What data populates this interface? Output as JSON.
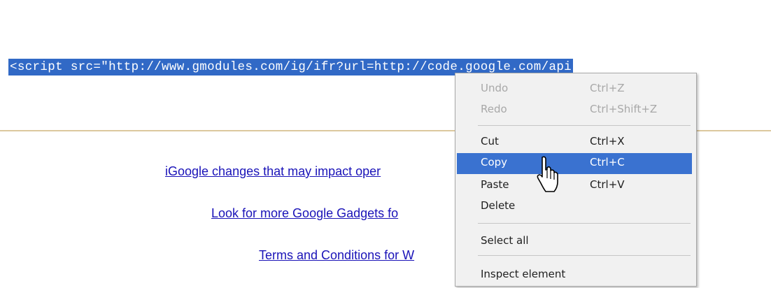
{
  "embed_code": "<script src=\"http://www.gmodules.com/ig/ifr?url=http://code.google.com/api",
  "links": [
    "iGoogle changes that may impact oper",
    "Look for more Google Gadgets fo",
    "Terms and Conditions for W"
  ],
  "context_menu": {
    "items": [
      {
        "label": "Undo",
        "shortcut": "Ctrl+Z",
        "state": "disabled"
      },
      {
        "label": "Redo",
        "shortcut": "Ctrl+Shift+Z",
        "state": "disabled"
      },
      {
        "label": "Cut",
        "shortcut": "Ctrl+X",
        "state": "enabled"
      },
      {
        "label": "Copy",
        "shortcut": "Ctrl+C",
        "state": "highlighted"
      },
      {
        "label": "Paste",
        "shortcut": "Ctrl+V",
        "state": "enabled"
      },
      {
        "label": "Delete",
        "shortcut": "",
        "state": "enabled"
      },
      {
        "label": "Select all",
        "shortcut": "",
        "state": "enabled"
      },
      {
        "label": "Inspect element",
        "shortcut": "",
        "state": "enabled"
      }
    ]
  },
  "colors": {
    "selection": "#3169c6",
    "menu_highlight": "#3a72d0",
    "link": "#1a13b8",
    "box_border": "#dcc89e"
  }
}
